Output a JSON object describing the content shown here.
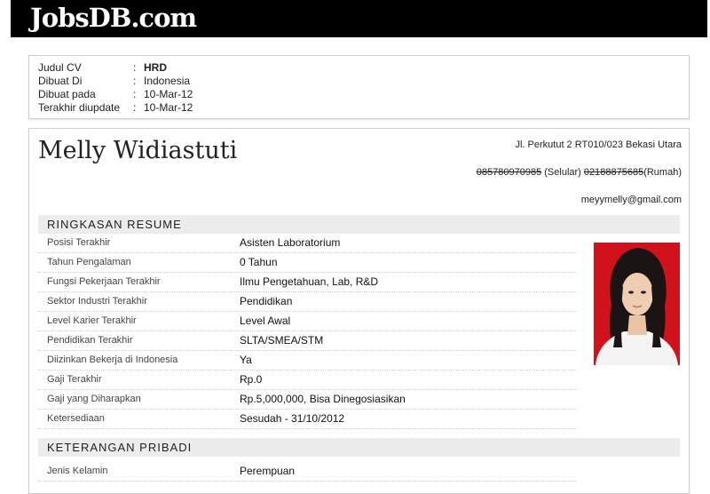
{
  "brand": {
    "logo_text": "JobsDB.com"
  },
  "cv_meta": [
    {
      "label": "Judul CV",
      "value": "HRD",
      "bold": true
    },
    {
      "label": "Dibuat Di",
      "value": "Indonesia"
    },
    {
      "label": "Dibuat pada",
      "value": "10-Mar-12"
    },
    {
      "label": "Terakhir diupdate",
      "value": "10-Mar-12"
    }
  ],
  "meta_separator": ":",
  "profile": {
    "name": "Melly Widiastuti",
    "address": "Jl. Perkutut 2 RT010/023 Bekasi Utara",
    "mobile": "085780970985",
    "mobile_label": "(Selular)",
    "home": "02188875685",
    "home_label": "(Rumah)",
    "email": "meyymelly@gmail.com"
  },
  "sections": {
    "summary": {
      "title": "RINGKASAN RESUME",
      "rows": [
        {
          "label": "Posisi Terakhir",
          "value": "Asisten Laboratorium"
        },
        {
          "label": "Tahun Pengalaman",
          "value": "0 Tahun"
        },
        {
          "label": "Fungsi Pekerjaan Terakhir",
          "value": "Ilmu Pengetahuan, Lab, R&D"
        },
        {
          "label": "Sektor Industri Terakhir",
          "value": "Pendidikan"
        },
        {
          "label": "Level Karier Terakhir",
          "value": "Level Awal"
        },
        {
          "label": "Pendidikan Terakhir",
          "value": "SLTA/SMEA/STM"
        },
        {
          "label": "Diizinkan Bekerja di Indonesia",
          "value": "Ya"
        },
        {
          "label": "Gaji Terakhir",
          "value": "Rp.0"
        },
        {
          "label": "Gaji yang Diharapkan",
          "value": "Rp.5,000,000, Bisa Dinegosiasikan"
        },
        {
          "label": "Ketersediaan",
          "value": "Sesudah - 31/10/2012"
        }
      ]
    },
    "personal": {
      "title": "KETERANGAN PRIBADI",
      "rows": [
        {
          "label": "Jenis Kelamin",
          "value": "Perempuan"
        }
      ]
    }
  },
  "colors": {
    "header_bg": "#000000",
    "section_bg": "#ececec",
    "photo_bg": "#d2121b"
  }
}
